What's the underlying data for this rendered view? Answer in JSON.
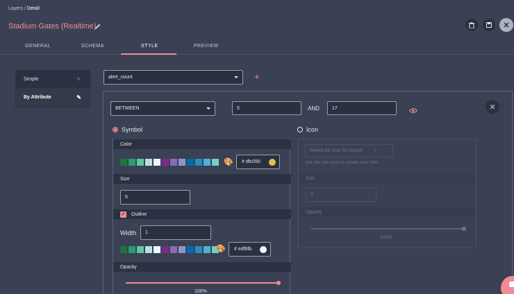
{
  "breadcrumb": {
    "parent": "Layers",
    "separator": " / ",
    "current": "Detail"
  },
  "title": "Stadium Gates (Realtime)",
  "tabs": [
    {
      "label": "GENERAL"
    },
    {
      "label": "SCHEMA"
    },
    {
      "label": "STYLE"
    },
    {
      "label": "PREVIEW"
    }
  ],
  "active_tab": "STYLE",
  "sidebar": {
    "items": [
      {
        "label": "Simple"
      },
      {
        "label": "By Attribute"
      }
    ]
  },
  "attribute_select": {
    "value": "alert_count"
  },
  "rule": {
    "operator": "BETWEEN",
    "min": "5",
    "and_label": "AND",
    "max": "17"
  },
  "symbol": {
    "label": "Symbol",
    "color_label": "Color",
    "color_hex": "# dfc050",
    "color_value": "#dfc050",
    "size_label": "Size",
    "size_value": "5",
    "outline_label": "Outline",
    "width_label": "Width",
    "width_value": "1",
    "outline_hex": "# edf8fb",
    "outline_value": "#edf8fb",
    "opacity_label": "Opacity",
    "opacity_percent": "100%",
    "opacity_fraction": 1.0
  },
  "icon": {
    "label": "Icon",
    "import_label": "Select An Icon To Import",
    "hint": "Icon file size must be smaller than 1Mb",
    "size_label": "Size",
    "size_value": "5",
    "opacity_label": "Opacity",
    "opacity_percent": "100%"
  },
  "palette": [
    "#1b7837",
    "#2a9d6a",
    "#66c2a4",
    "#b2e2e2",
    "#edf8fb",
    "#7b2a8c",
    "#8c6bb1",
    "#8c96c6",
    "#0868ac",
    "#2b8cbe",
    "#4eb3d3",
    "#7bccc4"
  ],
  "colors": {
    "accent": "#f28b94",
    "background": "#3a4154",
    "panel_dark": "#2b3142"
  }
}
